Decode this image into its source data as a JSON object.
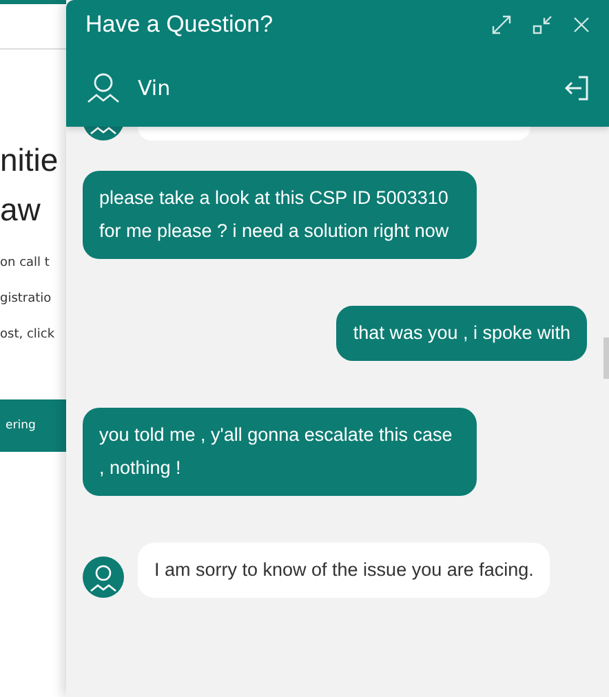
{
  "background_page": {
    "heading_lines": [
      "nitie",
      "aw"
    ],
    "body_lines": [
      "on call t",
      "gistratio",
      "ost, click"
    ],
    "button": "ering"
  },
  "chat": {
    "title": "Have a Question?",
    "agent": {
      "name": "Vin"
    },
    "messages": [
      {
        "kind": "agent"
      },
      {
        "kind": "received",
        "text": "please take a look at this CSP ID 5003310 for me please ? i need a solution right now"
      },
      {
        "kind": "sent",
        "text": "that was you , i spoke with"
      },
      {
        "kind": "received",
        "text": "you told me , y'all gonna escalate this case , nothing !"
      },
      {
        "kind": "agent",
        "text": "I am sorry to know of the issue you are facing."
      }
    ]
  }
}
